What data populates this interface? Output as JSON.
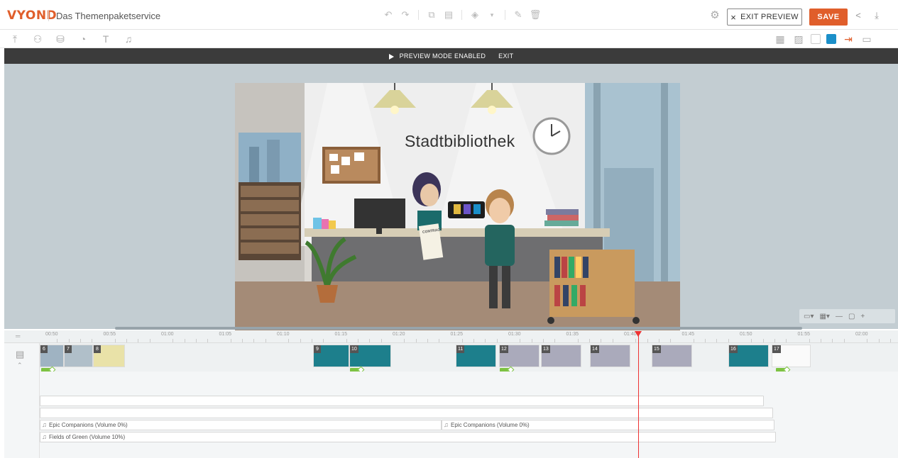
{
  "app": {
    "logo": "VYOND",
    "title": "Das Themenpaketservice"
  },
  "header": {
    "exit_preview_label": "EXIT PREVIEW",
    "save_label": "SAVE"
  },
  "preview_bar": {
    "message": "PREVIEW MODE ENABLED",
    "exit_label": "EXIT"
  },
  "stage": {
    "sign_text": "Stadtbibliothek",
    "contract_text": "CONTRACT"
  },
  "timeline": {
    "ruler_ticks": [
      "00:50",
      "00:55",
      "01:00",
      "01:05",
      "01:10",
      "01:15",
      "01:20",
      "01:25",
      "01:30",
      "01:35",
      "01:40",
      "01:45",
      "01:50",
      "01:55",
      "02:00"
    ],
    "scenes": [
      "6",
      "7",
      "8",
      "9",
      "10",
      "11",
      "12",
      "13",
      "14",
      "15",
      "16",
      "17"
    ],
    "audio_tracks": [
      {
        "label": "Epic Companions (Volume 0%)"
      },
      {
        "label": "Epic Companions (Volume 0%)"
      },
      {
        "label": "Fields of Green (Volume 10%)"
      }
    ]
  },
  "colors": {
    "brand": "#e05e2b",
    "teal_scene": "#1d7f8c",
    "playhead": "#ee3333",
    "transition": "#7dc242"
  }
}
